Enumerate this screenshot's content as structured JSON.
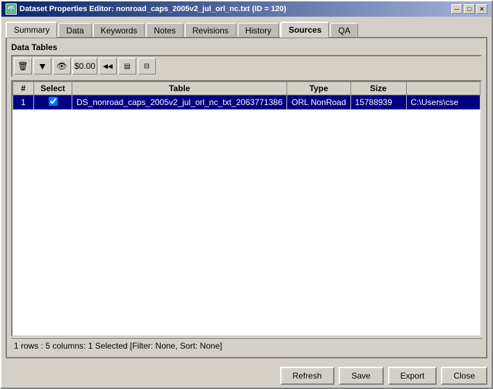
{
  "window": {
    "title": "Dataset Properties Editor: nonroad_caps_2005v2_jul_orl_nc.txt (ID = 120)",
    "title_icon": "🗃"
  },
  "tabs": [
    {
      "label": "Summary",
      "active": false
    },
    {
      "label": "Data",
      "active": false
    },
    {
      "label": "Keywords",
      "active": false
    },
    {
      "label": "Notes",
      "active": false
    },
    {
      "label": "Revisions",
      "active": false
    },
    {
      "label": "History",
      "active": false
    },
    {
      "label": "Sources",
      "active": true
    },
    {
      "label": "QA",
      "active": false
    }
  ],
  "panel": {
    "title": "Data Tables"
  },
  "toolbar": {
    "buttons": [
      {
        "name": "delete-icon",
        "symbol": "🗑",
        "label": "Delete"
      },
      {
        "name": "filter-icon",
        "symbol": "▼",
        "label": "Filter"
      },
      {
        "name": "view-icon",
        "symbol": "👁",
        "label": "View"
      },
      {
        "name": "money-icon",
        "symbol": "$0.00",
        "label": "Cost"
      },
      {
        "name": "first-icon",
        "symbol": "◀◀",
        "label": "First"
      },
      {
        "name": "copy-icon",
        "symbol": "📋",
        "label": "Copy"
      },
      {
        "name": "split-icon",
        "symbol": "⊟",
        "label": "Split"
      }
    ]
  },
  "table": {
    "columns": [
      "#",
      "Select",
      "Table",
      "Type",
      "Size",
      ""
    ],
    "rows": [
      {
        "num": "1",
        "select": true,
        "table": "DS_nonroad_caps_2005v2_jul_orl_nc_txt_2063771386",
        "type": "ORL NonRoad",
        "size": "15788939",
        "path": "C:\\Users\\cse"
      }
    ]
  },
  "status": {
    "text": "1 rows : 5 columns: 1 Selected [Filter: None, Sort: None]"
  },
  "buttons": {
    "refresh": "Refresh",
    "save": "Save",
    "export": "Export",
    "close": "Close"
  },
  "titlebar_buttons": {
    "minimize": "─",
    "maximize": "□",
    "close": "✕"
  }
}
